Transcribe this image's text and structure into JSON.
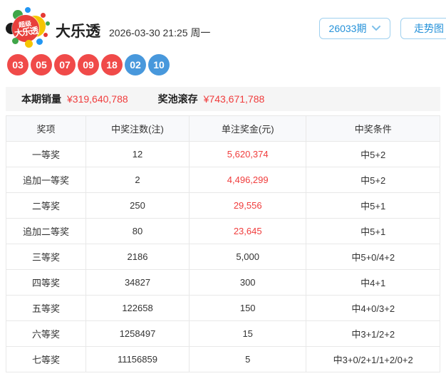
{
  "header": {
    "logo": {
      "line1": "超级",
      "line2": "大乐透"
    },
    "title": "大乐透",
    "datetime": "2026-03-30 21:25 周一",
    "issue_select": "26033期",
    "trend_button": "走势图"
  },
  "balls": {
    "front": [
      "03",
      "05",
      "07",
      "09",
      "18"
    ],
    "back": [
      "02",
      "10"
    ]
  },
  "colors": {
    "front_ball": "#f04a49",
    "back_ball": "#4898dc",
    "amount_red": "#f03c3c",
    "accent_blue": "#2491d9"
  },
  "sales": {
    "label1": "本期销量",
    "value1": "¥319,640,788",
    "label2": "奖池滚存",
    "value2": "¥743,671,788"
  },
  "table": {
    "headers": [
      "奖项",
      "中奖注数(注)",
      "单注奖金(元)",
      "中奖条件"
    ],
    "rows": [
      {
        "name": "一等奖",
        "count": "12",
        "amount": "5,620,374",
        "condition": "中5+2",
        "red": true
      },
      {
        "name": "追加一等奖",
        "count": "2",
        "amount": "4,496,299",
        "condition": "中5+2",
        "red": true
      },
      {
        "name": "二等奖",
        "count": "250",
        "amount": "29,556",
        "condition": "中5+1",
        "red": true
      },
      {
        "name": "追加二等奖",
        "count": "80",
        "amount": "23,645",
        "condition": "中5+1",
        "red": true
      },
      {
        "name": "三等奖",
        "count": "2186",
        "amount": "5,000",
        "condition": "中5+0/4+2",
        "red": false
      },
      {
        "name": "四等奖",
        "count": "34827",
        "amount": "300",
        "condition": "中4+1",
        "red": false
      },
      {
        "name": "五等奖",
        "count": "122658",
        "amount": "150",
        "condition": "中4+0/3+2",
        "red": false
      },
      {
        "name": "六等奖",
        "count": "1258497",
        "amount": "15",
        "condition": "中3+1/2+2",
        "red": false
      },
      {
        "name": "七等奖",
        "count": "11156859",
        "amount": "5",
        "condition": "中3+0/2+1/1+2/0+2",
        "red": false
      }
    ]
  }
}
